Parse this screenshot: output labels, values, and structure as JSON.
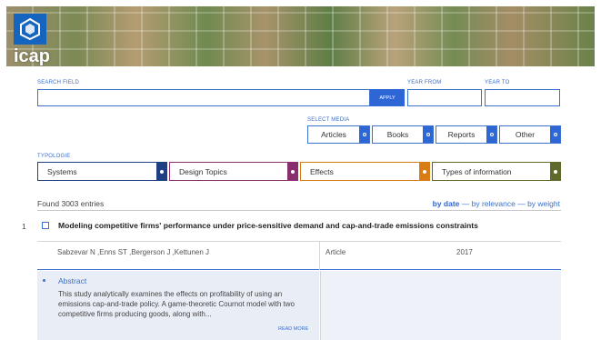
{
  "banner": {
    "logo_text": "icap"
  },
  "search": {
    "field_label": "SEARCH FIELD",
    "field_value": "",
    "apply_label": "APPLY",
    "year_from_label": "YEAR FROM",
    "year_from_value": "",
    "year_to_label": "YEAR TO",
    "year_to_value": ""
  },
  "media": {
    "label": "SELECT MEDIA",
    "items": [
      {
        "label": "Articles"
      },
      {
        "label": "Books"
      },
      {
        "label": "Reports"
      },
      {
        "label": "Other"
      }
    ]
  },
  "typology": {
    "label": "TYPOLOGIE",
    "items": [
      {
        "label": "Systems",
        "color": "#1e3f82"
      },
      {
        "label": "Design Topics",
        "color": "#8a2f6e"
      },
      {
        "label": "Effects",
        "color": "#d97c14"
      },
      {
        "label": "Types of information",
        "color": "#5f6a2a"
      }
    ]
  },
  "results": {
    "found_text": "Found 3003 entries",
    "sort_by_date": "by date",
    "sort_sep1": " — ",
    "sort_by_relevance": "by relevance",
    "sort_sep2": " — ",
    "sort_by_weight": "by weight"
  },
  "entry": {
    "number": "1",
    "title": "Modeling competitive firms' performance under price-sensitive demand and cap-and-trade emissions constraints",
    "authors": "Sabzevar N ,Enns ST ,Bergerson J ,Kettunen J",
    "type": "Article",
    "year": "2017",
    "abstract_label": "Abstract",
    "abstract_text": "This study analytically examines the effects on profitability of using an emissions cap-and-trade policy. A game-theoretic Cournot model with two competitive firms producing goods, along with...",
    "read_more": "READ MORE"
  }
}
